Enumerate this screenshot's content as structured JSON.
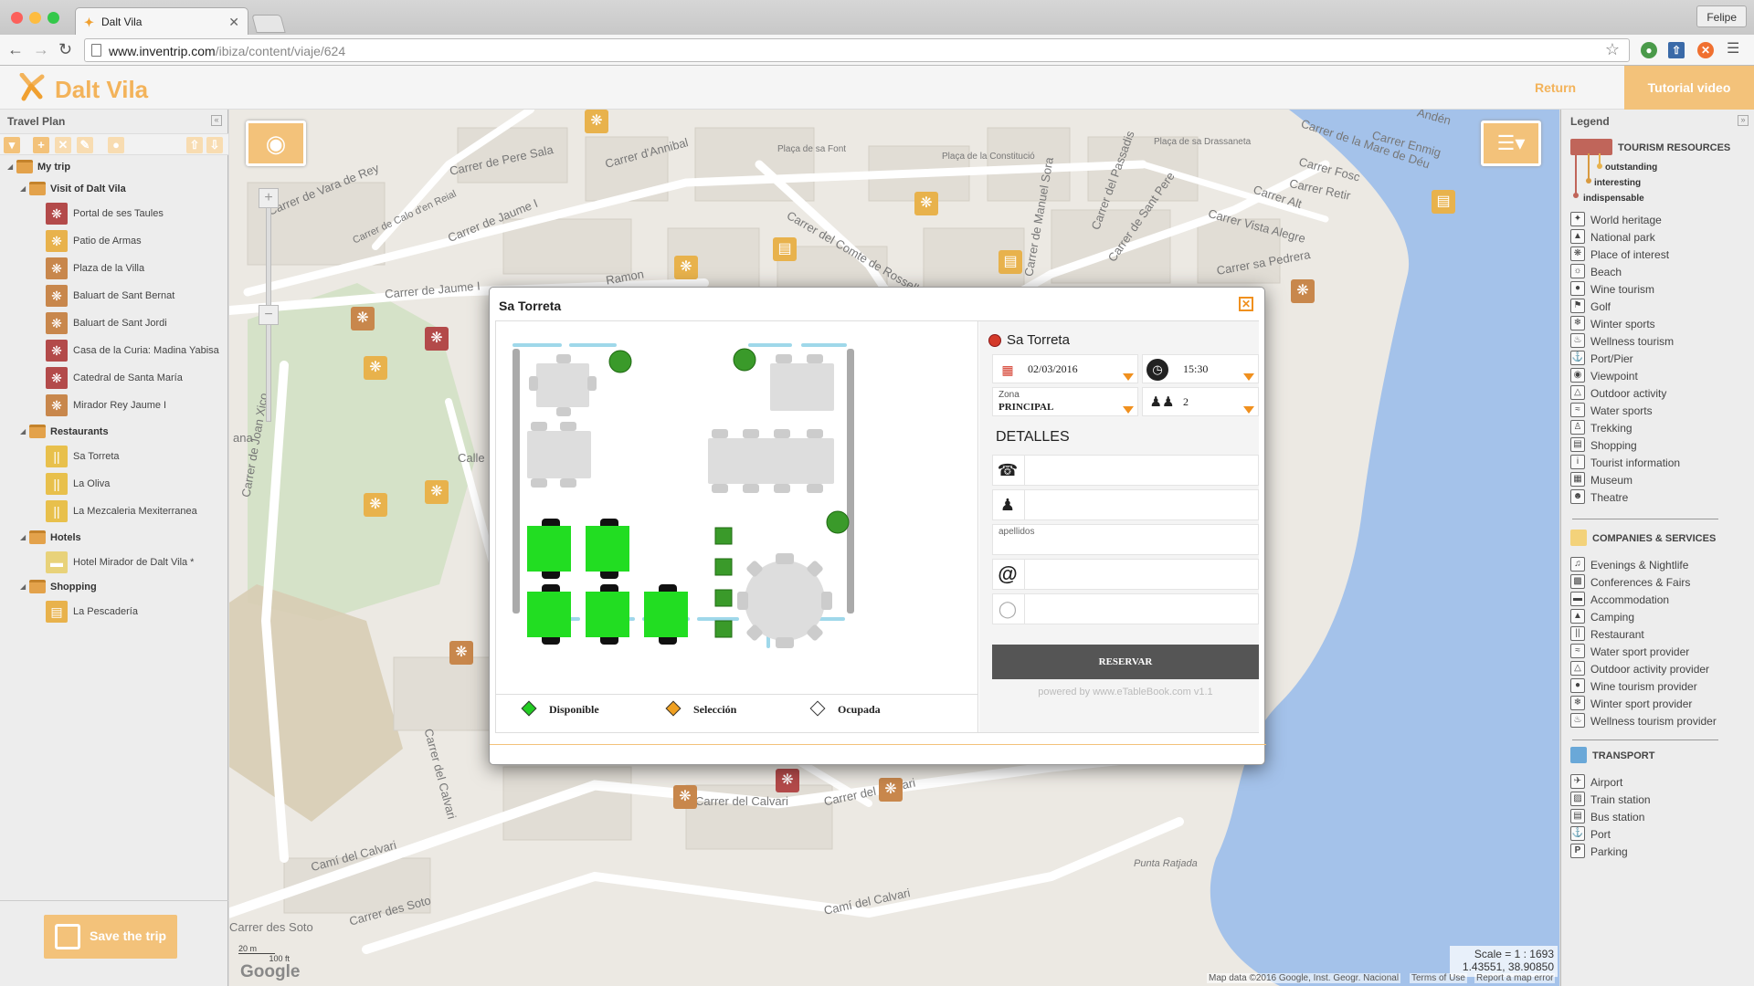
{
  "browser": {
    "tab_title": "Dalt Vila",
    "url_host": "www.inventrip.com",
    "url_path": "/ibiza/content/viaje/624",
    "profile_name": "Felipe"
  },
  "header": {
    "brand": "Dalt Vila",
    "return_label": "Return",
    "tutorial_label": "Tutorial video"
  },
  "sidebar": {
    "title": "Travel Plan",
    "root": "My trip",
    "groups": [
      {
        "label": "Visit of Dalt Vila",
        "items": [
          "Portal de ses Taules",
          "Patio de Armas",
          "Plaza de la Villa",
          "Baluart de Sant Bernat",
          "Baluart de Sant Jordi",
          "Casa de la Curia: Madina Yabisa",
          "Catedral de Santa María",
          "Mirador Rey Jaume I"
        ]
      },
      {
        "label": "Restaurants",
        "items": [
          "Sa Torreta",
          "La Oliva",
          "La Mezcaleria Mexiterranea"
        ]
      },
      {
        "label": "Hotels",
        "items": [
          "Hotel Mirador de Dalt Vila *"
        ]
      },
      {
        "label": "Shopping",
        "items": [
          "La Pescadería"
        ]
      }
    ],
    "save_label": "Save the trip"
  },
  "map": {
    "streets": [
      "Carrer de Pere Sala",
      "Carrer d'Annibal",
      "Plaça de sa Font",
      "Carrer de Vara de Rey",
      "Carrer de Calo d'en Reial",
      "Carrer de Jaume I",
      "Carrer del Comte de Rossello",
      "Carrer de Jaume I",
      "Ramon",
      "Carrer de Joan Xico",
      "Carrer del Passadis",
      "Carrer de Sant Pere",
      "Plaça de sa Drassaneta",
      "Carrer Enmig",
      "Carrer de la Mare de Déu",
      "Carrer Fosc",
      "Carrer Retir",
      "Carrer Alt",
      "Carrer Vista Alegre",
      "Carrer sa Pedrera",
      "Carrer de Manuel Sora",
      "Plaça de la Constitució",
      "Carrer del Calvari",
      "Camí del Calvari",
      "Carrer des Soto",
      "Punta Ratjada",
      "Calle",
      "ana",
      "Andén",
      "Carrer del Calvari",
      "Carrer del Calvari",
      "Camí del Calvari",
      "Carrer des Soto"
    ],
    "scale_text": "Scale = 1 : 1693",
    "coords_text": "1.43551, 38.90850",
    "attribution": "Map data ©2016 Google, Inst. Geogr. Nacional",
    "terms": "Terms of Use",
    "report": "Report a map error",
    "google": "Google",
    "ruler_m": "20 m",
    "ruler_ft": "100 ft"
  },
  "legend": {
    "title": "Legend",
    "tourism_title": "TOURISM RESOURCES",
    "importance": [
      "outstanding",
      "interesting",
      "indispensable"
    ],
    "tourism_items": [
      "World heritage",
      "National park",
      "Place of interest",
      "Beach",
      "Wine tourism",
      "Golf",
      "Winter sports",
      "Wellness tourism",
      "Port/Pier",
      "Viewpoint",
      "Outdoor activity",
      "Water sports",
      "Trekking",
      "Shopping",
      "Tourist information",
      "Museum",
      "Theatre"
    ],
    "companies_title": "COMPANIES & SERVICES",
    "companies_items": [
      "Evenings & Nightlife",
      "Conferences & Fairs",
      "Accommodation",
      "Camping",
      "Restaurant",
      "Water sport provider",
      "Outdoor activity provider",
      "Wine tourism provider",
      "Winter sport provider",
      "Wellness tourism provider"
    ],
    "transport_title": "TRANSPORT",
    "transport_items": [
      "Airport",
      "Train station",
      "Bus station",
      "Port",
      "Parking"
    ],
    "colors": {
      "tourism": "#c0655a",
      "companies": "#f3d27a",
      "transport": "#6aa8d8"
    }
  },
  "modal": {
    "title": "Sa Torreta",
    "plan_legend": [
      "Disponible",
      "Selección",
      "Ocupada"
    ],
    "plan_legend_colors": [
      "#22cc22",
      "#f0a020",
      "#ffffff"
    ],
    "form": {
      "restaurant": "Sa Torreta",
      "date": "02/03/2016",
      "time": "15:30",
      "zone_label": "Zona",
      "zone_value": "PRINCIPAL",
      "people": "2",
      "details_heading": "DETALLES",
      "surname_placeholder": "apellidos",
      "reserve_label": "RESERVAR",
      "powered_by": "powered by www.eTableBook.com v1.1"
    }
  },
  "colors": {
    "accent": "#f3c27a",
    "brand": "#f3b35a",
    "available": "#22dd22"
  }
}
